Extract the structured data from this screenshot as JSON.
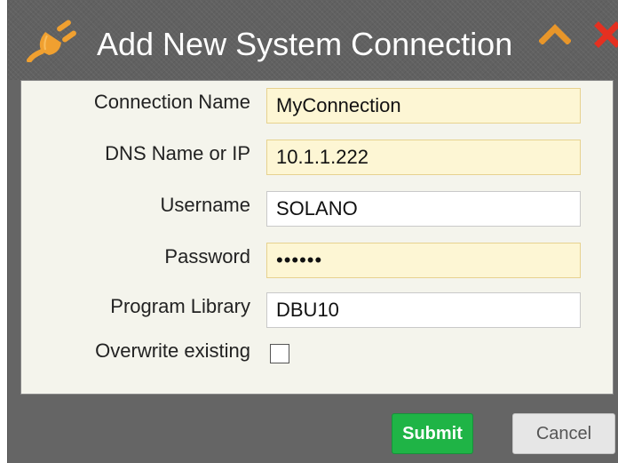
{
  "dialog": {
    "title": "Add New System Connection",
    "icons": {
      "plug": "plug-icon",
      "collapse": "chevron-up-icon",
      "close": "close-icon"
    }
  },
  "form": {
    "fields": [
      {
        "label": "Connection Name",
        "value": "MyConnection",
        "required": true
      },
      {
        "label": "DNS Name or IP",
        "value": "10.1.1.222",
        "required": true
      },
      {
        "label": "Username",
        "value": "SOLANO",
        "required": false
      },
      {
        "label": "Password",
        "value": "••••••",
        "required": true
      },
      {
        "label": "Program Library",
        "value": "DBU10",
        "required": false
      }
    ],
    "overwrite": {
      "label": "Overwrite existing",
      "checked": false
    }
  },
  "buttons": {
    "submit": "Submit",
    "cancel": "Cancel"
  },
  "colors": {
    "required_field_bg": "#fdf6d4",
    "submit_green": "#1fb446",
    "plug_orange": "#f0a030",
    "close_red": "#e53020",
    "chevron_orange": "#e8962a"
  }
}
